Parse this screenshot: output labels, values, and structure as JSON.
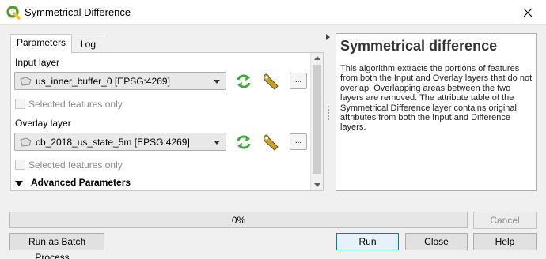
{
  "window": {
    "title": "Symmetrical Difference",
    "close_icon": "close-icon"
  },
  "tabs": [
    {
      "label": "Parameters"
    },
    {
      "label": "Log"
    }
  ],
  "params": {
    "input_layer_label": "Input layer",
    "input_layer_value": "us_inner_buffer_0 [EPSG:4269]",
    "input_selected_label": "Selected features only",
    "overlay_layer_label": "Overlay layer",
    "overlay_layer_value": "cb_2018_us_state_5m [EPSG:4269]",
    "overlay_selected_label": "Selected features only",
    "advanced_label": "Advanced Parameters",
    "browse_label": "..."
  },
  "help": {
    "title": "Symmetrical difference",
    "body": "This algorithm extracts the portions of features from both the Input and Overlay layers that do not overlap. Overlapping areas between the two layers are removed. The attribute table of the Symmetrical Difference layer contains original attributes from both the Input and Difference layers."
  },
  "progress": {
    "value": 0,
    "text": "0%"
  },
  "buttons": {
    "cancel": "Cancel",
    "batch": "Run as Batch Process…",
    "run": "Run",
    "close": "Close",
    "help": "Help"
  },
  "colors": {
    "qgis_green": "#589632",
    "qgis_yellow": "#f1c21b",
    "iterate_green": "#3aa935"
  }
}
